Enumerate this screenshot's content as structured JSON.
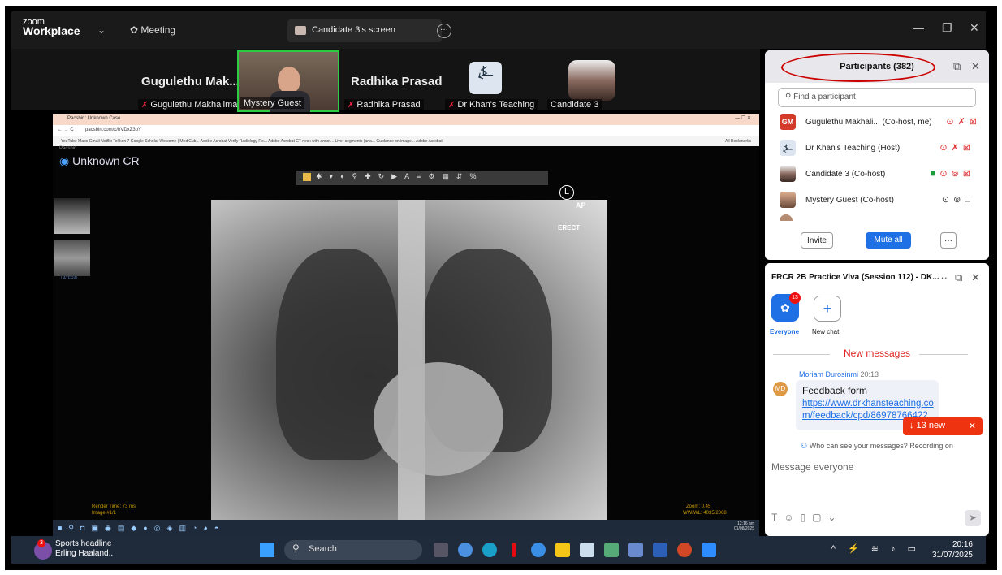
{
  "app": {
    "logo_top": "zoom",
    "logo_bottom": "Workplace",
    "meeting_label": "Meeting",
    "tab_label": "Candidate 3's screen"
  },
  "participants_strip": [
    {
      "name": "Gugulethu Mak...",
      "label": "Gugulethu Makhalima"
    },
    {
      "name": "",
      "label": "Mystery Guest"
    },
    {
      "name": "Radhika Prasad",
      "label": "Radhika Prasad"
    },
    {
      "name": "",
      "label": "Dr Khan's Teaching"
    },
    {
      "name": "",
      "label": "Candidate 3"
    }
  ],
  "browser": {
    "tab": "Pacsbin: Unknown Case",
    "url": "pacsbin.com/c/bVDxZ3pY",
    "bookmarks": "YouTube  Maps  Gmail  Netflix  Tekken 7  Google Scholar  Welcome | MediCub...  Adobe Acrobat  Verify Radiology Re...  Adobe Acrobat  CT neck with annot...  Liver segments (ana...  Guidance on image...  Adobe Acrobat",
    "all_bookmarks": "All Bookmarks",
    "site": "Pacsbin"
  },
  "viewer": {
    "title": "Unknown CR",
    "ap": "AP",
    "erect": "ERECT",
    "marker": "L",
    "render_time": "Render Time: 73 ms",
    "image_no": "Image #1/1",
    "zoom": "Zoom: 0.45",
    "wwwl": "WW/WL: 4035/2068",
    "thumb2": "LATERAL",
    "mini_time": "12:16 am",
    "mini_date": "01/08/2025"
  },
  "participants_panel": {
    "title": "Participants (382)",
    "search_placeholder": "Find a participant",
    "rows": [
      {
        "initials": "GM",
        "name": "Gugulethu Makhali... (Co-host, me)"
      },
      {
        "initials": "",
        "name": "Dr Khan's Teaching (Host)"
      },
      {
        "initials": "",
        "name": "Candidate 3 (Co-host)"
      },
      {
        "initials": "",
        "name": "Mystery Guest (Co-host)"
      }
    ],
    "invite": "Invite",
    "mute_all": "Mute all",
    "more": "···"
  },
  "chat": {
    "title": "FRCR 2B Practice Viva (Session 112) - DK...",
    "everyone": "Everyone",
    "badge": "13",
    "new_chat": "New chat",
    "new_messages": "New messages",
    "sender": "Moriam Durosinmi",
    "time": "20:13",
    "avatar": "MD",
    "message": "Feedback form",
    "link": "https://www.drkhansteaching.co m/feedback/cpd/86978766422",
    "new_pill": "↓  13 new",
    "who_can": "Who can see your messages? Recording on",
    "input_placeholder": "Message everyone"
  },
  "taskbar": {
    "news_title": "Sports headline",
    "news_sub": "Erling Haaland...",
    "news_badge": "3",
    "search": "Search",
    "time": "20:16",
    "date": "31/07/2025"
  },
  "colors": {
    "accent": "#1f6fe5",
    "alert": "#e31b23",
    "tile_border": "#2ecc40"
  }
}
